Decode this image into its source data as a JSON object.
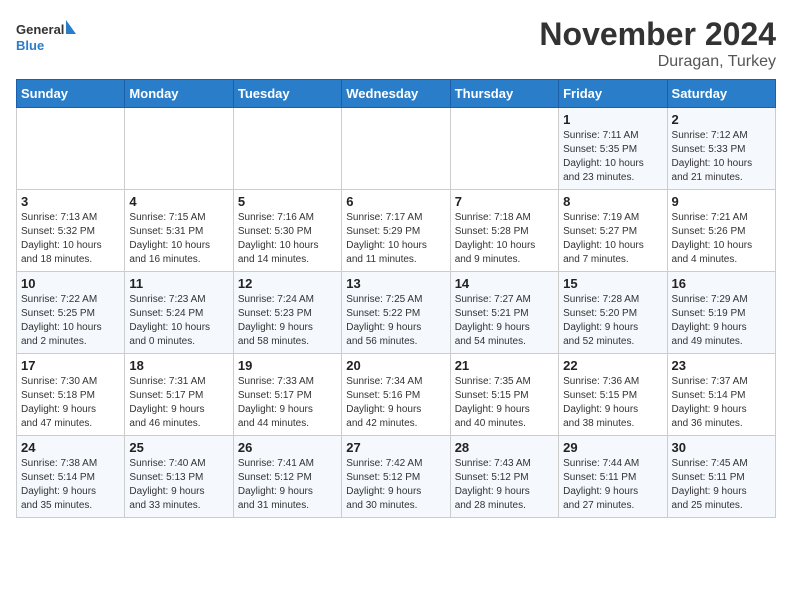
{
  "logo": {
    "general": "General",
    "blue": "Blue"
  },
  "header": {
    "month": "November 2024",
    "location": "Duragan, Turkey"
  },
  "weekdays": [
    "Sunday",
    "Monday",
    "Tuesday",
    "Wednesday",
    "Thursday",
    "Friday",
    "Saturday"
  ],
  "weeks": [
    [
      {
        "day": "",
        "info": ""
      },
      {
        "day": "",
        "info": ""
      },
      {
        "day": "",
        "info": ""
      },
      {
        "day": "",
        "info": ""
      },
      {
        "day": "",
        "info": ""
      },
      {
        "day": "1",
        "info": "Sunrise: 7:11 AM\nSunset: 5:35 PM\nDaylight: 10 hours\nand 23 minutes."
      },
      {
        "day": "2",
        "info": "Sunrise: 7:12 AM\nSunset: 5:33 PM\nDaylight: 10 hours\nand 21 minutes."
      }
    ],
    [
      {
        "day": "3",
        "info": "Sunrise: 7:13 AM\nSunset: 5:32 PM\nDaylight: 10 hours\nand 18 minutes."
      },
      {
        "day": "4",
        "info": "Sunrise: 7:15 AM\nSunset: 5:31 PM\nDaylight: 10 hours\nand 16 minutes."
      },
      {
        "day": "5",
        "info": "Sunrise: 7:16 AM\nSunset: 5:30 PM\nDaylight: 10 hours\nand 14 minutes."
      },
      {
        "day": "6",
        "info": "Sunrise: 7:17 AM\nSunset: 5:29 PM\nDaylight: 10 hours\nand 11 minutes."
      },
      {
        "day": "7",
        "info": "Sunrise: 7:18 AM\nSunset: 5:28 PM\nDaylight: 10 hours\nand 9 minutes."
      },
      {
        "day": "8",
        "info": "Sunrise: 7:19 AM\nSunset: 5:27 PM\nDaylight: 10 hours\nand 7 minutes."
      },
      {
        "day": "9",
        "info": "Sunrise: 7:21 AM\nSunset: 5:26 PM\nDaylight: 10 hours\nand 4 minutes."
      }
    ],
    [
      {
        "day": "10",
        "info": "Sunrise: 7:22 AM\nSunset: 5:25 PM\nDaylight: 10 hours\nand 2 minutes."
      },
      {
        "day": "11",
        "info": "Sunrise: 7:23 AM\nSunset: 5:24 PM\nDaylight: 10 hours\nand 0 minutes."
      },
      {
        "day": "12",
        "info": "Sunrise: 7:24 AM\nSunset: 5:23 PM\nDaylight: 9 hours\nand 58 minutes."
      },
      {
        "day": "13",
        "info": "Sunrise: 7:25 AM\nSunset: 5:22 PM\nDaylight: 9 hours\nand 56 minutes."
      },
      {
        "day": "14",
        "info": "Sunrise: 7:27 AM\nSunset: 5:21 PM\nDaylight: 9 hours\nand 54 minutes."
      },
      {
        "day": "15",
        "info": "Sunrise: 7:28 AM\nSunset: 5:20 PM\nDaylight: 9 hours\nand 52 minutes."
      },
      {
        "day": "16",
        "info": "Sunrise: 7:29 AM\nSunset: 5:19 PM\nDaylight: 9 hours\nand 49 minutes."
      }
    ],
    [
      {
        "day": "17",
        "info": "Sunrise: 7:30 AM\nSunset: 5:18 PM\nDaylight: 9 hours\nand 47 minutes."
      },
      {
        "day": "18",
        "info": "Sunrise: 7:31 AM\nSunset: 5:17 PM\nDaylight: 9 hours\nand 46 minutes."
      },
      {
        "day": "19",
        "info": "Sunrise: 7:33 AM\nSunset: 5:17 PM\nDaylight: 9 hours\nand 44 minutes."
      },
      {
        "day": "20",
        "info": "Sunrise: 7:34 AM\nSunset: 5:16 PM\nDaylight: 9 hours\nand 42 minutes."
      },
      {
        "day": "21",
        "info": "Sunrise: 7:35 AM\nSunset: 5:15 PM\nDaylight: 9 hours\nand 40 minutes."
      },
      {
        "day": "22",
        "info": "Sunrise: 7:36 AM\nSunset: 5:15 PM\nDaylight: 9 hours\nand 38 minutes."
      },
      {
        "day": "23",
        "info": "Sunrise: 7:37 AM\nSunset: 5:14 PM\nDaylight: 9 hours\nand 36 minutes."
      }
    ],
    [
      {
        "day": "24",
        "info": "Sunrise: 7:38 AM\nSunset: 5:14 PM\nDaylight: 9 hours\nand 35 minutes."
      },
      {
        "day": "25",
        "info": "Sunrise: 7:40 AM\nSunset: 5:13 PM\nDaylight: 9 hours\nand 33 minutes."
      },
      {
        "day": "26",
        "info": "Sunrise: 7:41 AM\nSunset: 5:12 PM\nDaylight: 9 hours\nand 31 minutes."
      },
      {
        "day": "27",
        "info": "Sunrise: 7:42 AM\nSunset: 5:12 PM\nDaylight: 9 hours\nand 30 minutes."
      },
      {
        "day": "28",
        "info": "Sunrise: 7:43 AM\nSunset: 5:12 PM\nDaylight: 9 hours\nand 28 minutes."
      },
      {
        "day": "29",
        "info": "Sunrise: 7:44 AM\nSunset: 5:11 PM\nDaylight: 9 hours\nand 27 minutes."
      },
      {
        "day": "30",
        "info": "Sunrise: 7:45 AM\nSunset: 5:11 PM\nDaylight: 9 hours\nand 25 minutes."
      }
    ]
  ]
}
